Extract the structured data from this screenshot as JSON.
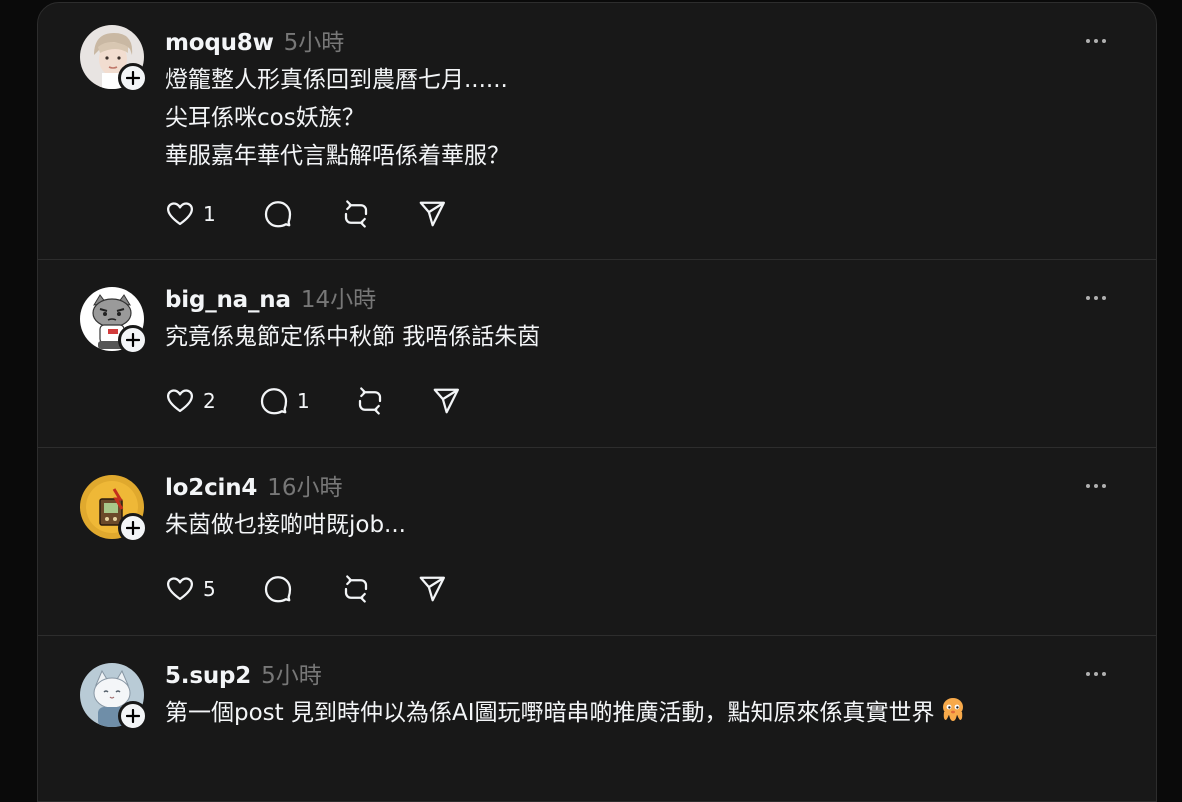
{
  "posts": [
    {
      "username": "moqu8w",
      "time": "5小時",
      "lines": [
        "燈籠整人形真係回到農曆七月......",
        "尖耳係咪cos妖族？",
        "華服嘉年華代言點解唔係着華服？"
      ],
      "likes": "1",
      "replies": "",
      "avatar": "person-photo"
    },
    {
      "username": "big_na_na",
      "time": "14小時",
      "lines": [
        "究竟係鬼節定係中秋節 我唔係話朱茵"
      ],
      "likes": "2",
      "replies": "1",
      "avatar": "grumpy-cat-cartoon"
    },
    {
      "username": "lo2cin4",
      "time": "16小時",
      "lines": [
        "朱茵做乜接啲咁既job..."
      ],
      "likes": "5",
      "replies": "",
      "avatar": "yellow-illustration"
    },
    {
      "username": "5.sup2",
      "time": "5小時",
      "lines": [
        "第一個post 見到時仲以為係AI圖玩嘢暗串啲推廣活動，點知原來係真實世界"
      ],
      "likes": "",
      "replies": "",
      "avatar": "white-cat-cartoon",
      "trailing_emoji": "octopus-emoji"
    }
  ],
  "icons": {
    "like": "heart-icon",
    "reply": "comment-bubble-icon",
    "repost": "repost-icon",
    "share": "send-icon",
    "more": "more-horizontal-icon",
    "follow": "plus-icon"
  },
  "colors": {
    "background": "#0a0a0a",
    "card": "#181818",
    "divider": "#2d2d2d",
    "text": "#f3f5f7",
    "muted": "#777777"
  }
}
